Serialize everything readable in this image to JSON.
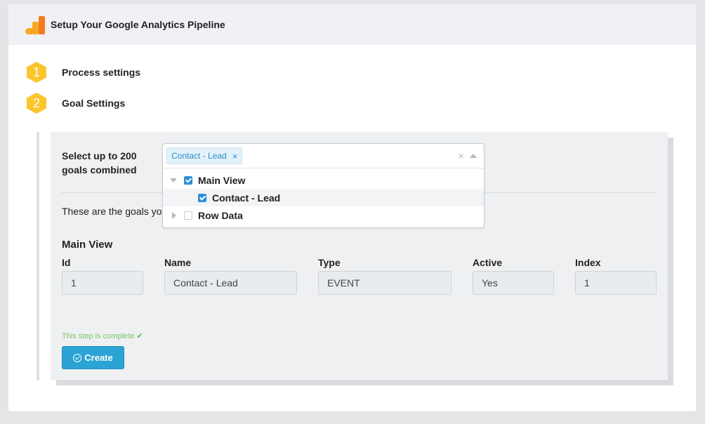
{
  "header": {
    "title": "Setup Your Google Analytics Pipeline",
    "logo_icon": "google-analytics-logo"
  },
  "steps": [
    {
      "number": "1",
      "label": "Process settings"
    },
    {
      "number": "2",
      "label": "Goal Settings"
    }
  ],
  "goal_settings": {
    "select_label_line1": "Select up to 200",
    "select_label_line2": "goals combined",
    "info_text": "These are the goals yo",
    "dropdown": {
      "selected_tags": [
        {
          "label": "Contact - Lead",
          "remove": "×"
        }
      ],
      "clear_all": "×",
      "options": [
        {
          "label": "Main View",
          "checked": true,
          "expanded": true,
          "level": 0
        },
        {
          "label": "Contact - Lead",
          "checked": true,
          "level": 1
        },
        {
          "label": "Row Data",
          "checked": false,
          "expanded": false,
          "level": 0
        }
      ]
    },
    "section_title": "Main View",
    "columns": [
      {
        "header": "Id",
        "value": "1"
      },
      {
        "header": "Name",
        "value": "Contact - Lead"
      },
      {
        "header": "Type",
        "value": "EVENT"
      },
      {
        "header": "Active",
        "value": "Yes"
      },
      {
        "header": "Index",
        "value": "1"
      }
    ],
    "status_text": "This step is complete",
    "create_button": "Create"
  },
  "colors": {
    "accent": "#2ba3d4",
    "step_badge": "#fbc52d",
    "complete_text": "#7cc36a"
  }
}
